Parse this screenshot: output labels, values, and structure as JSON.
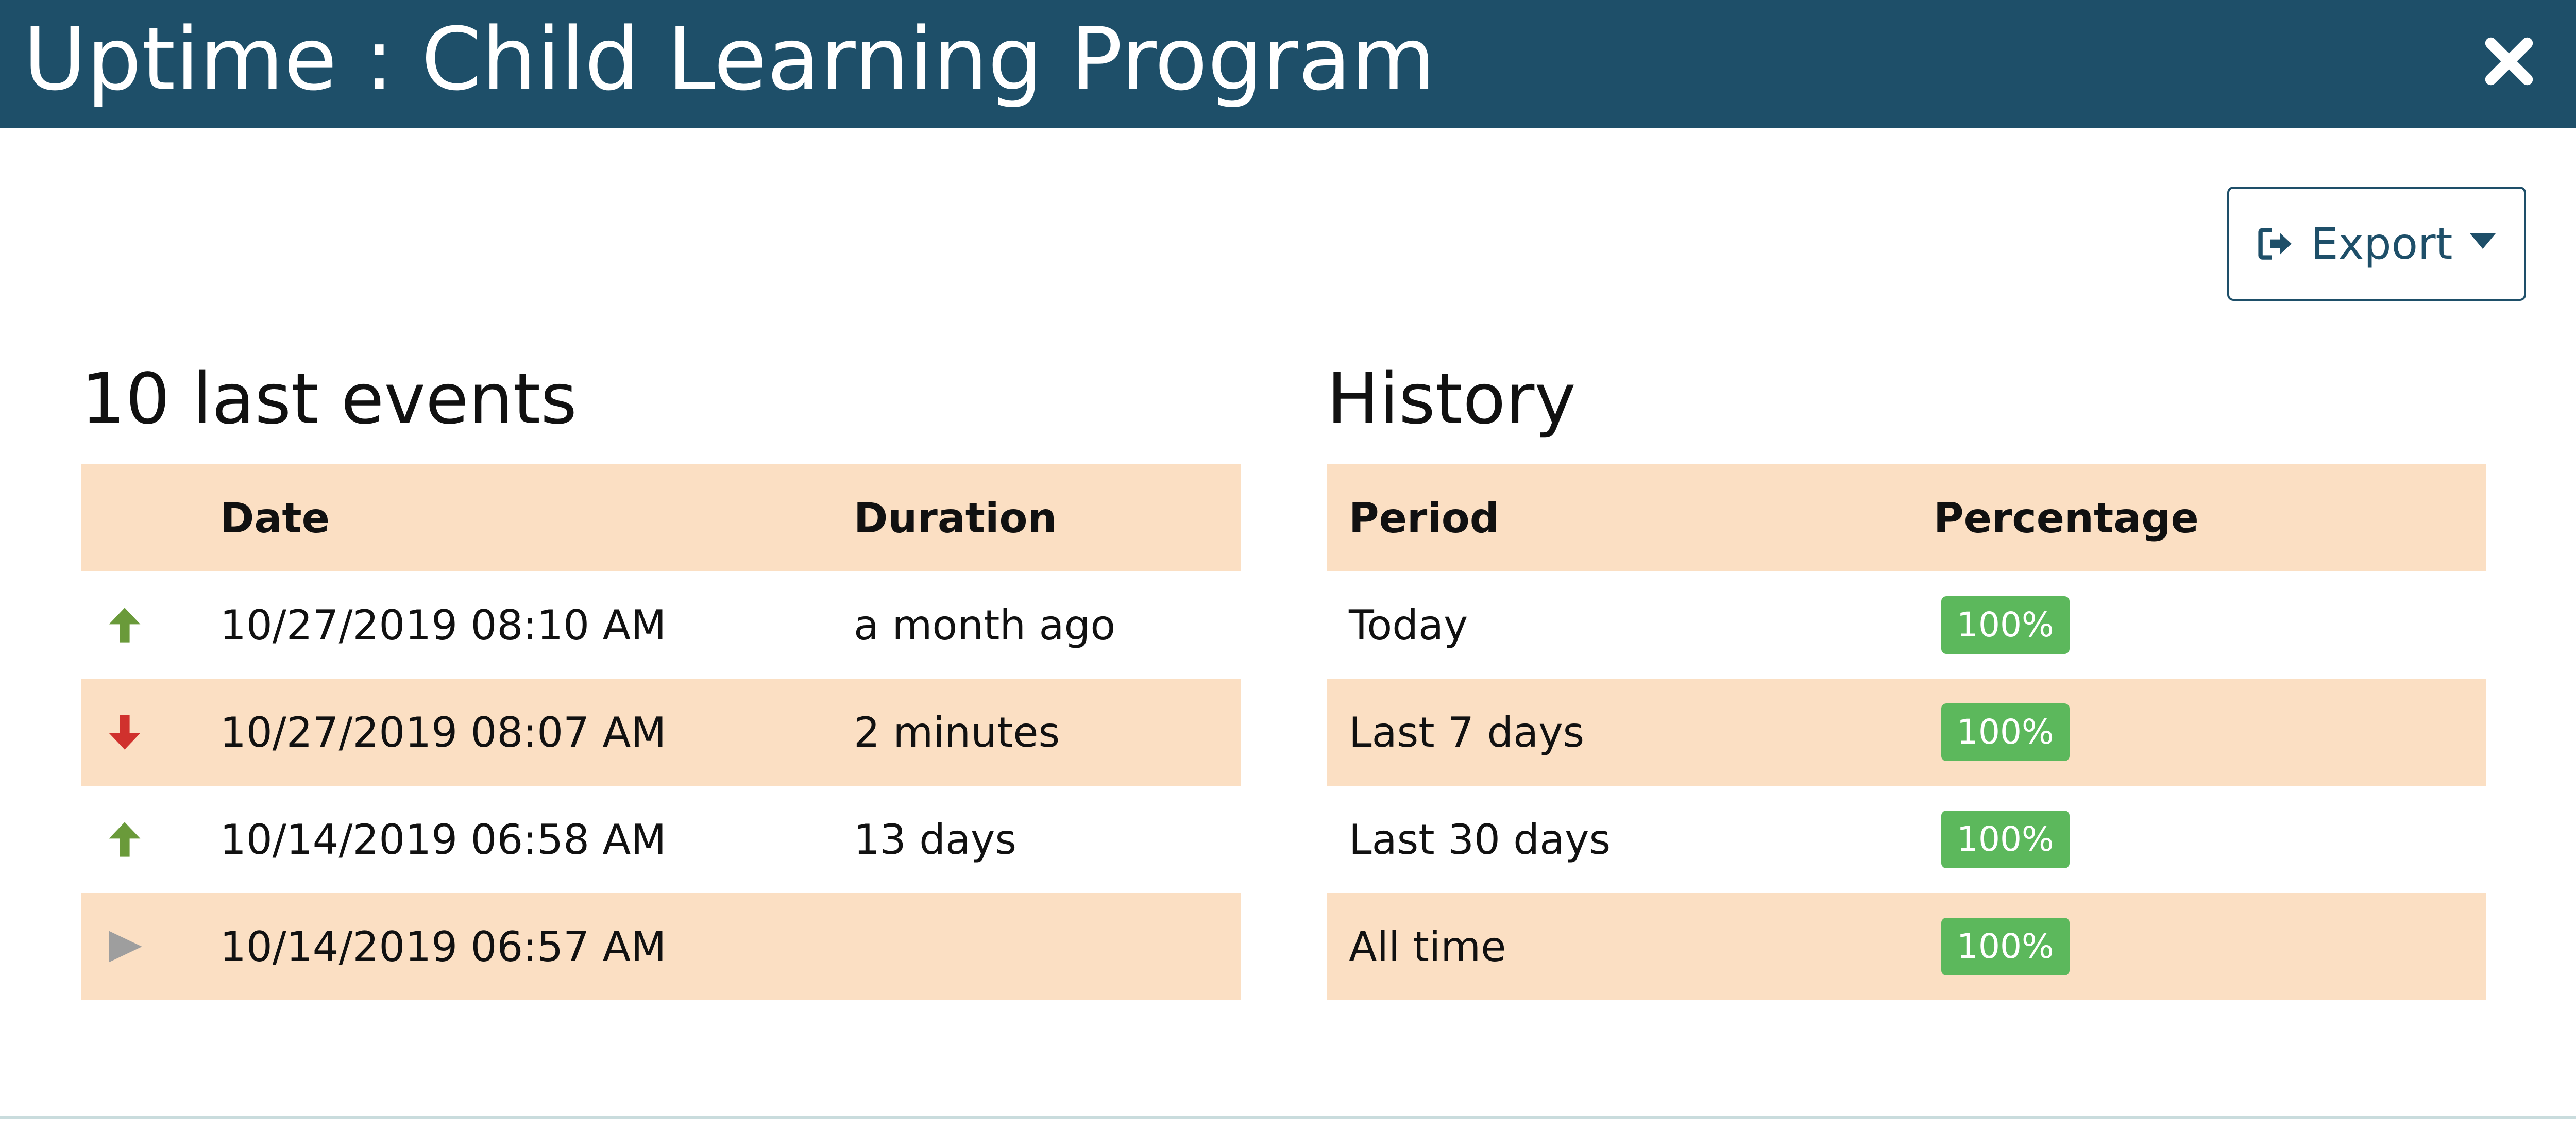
{
  "header": {
    "title": "Uptime : Child Learning Program",
    "close_icon": "close-icon"
  },
  "toolbar": {
    "export_label": "Export",
    "export_icon": "sign-out-icon",
    "caret_icon": "caret-down-icon"
  },
  "events": {
    "title": "10 last events",
    "columns": [
      "",
      "Date",
      "Duration"
    ],
    "rows": [
      {
        "status": "up",
        "icon": "arrow-up-icon",
        "date": "10/27/2019 08:10 AM",
        "duration": "a month ago"
      },
      {
        "status": "down",
        "icon": "arrow-down-icon",
        "date": "10/27/2019 08:07 AM",
        "duration": "2 minutes"
      },
      {
        "status": "up",
        "icon": "arrow-up-icon",
        "date": "10/14/2019 06:58 AM",
        "duration": "13 days"
      },
      {
        "status": "started",
        "icon": "play-icon",
        "date": "10/14/2019 06:57 AM",
        "duration": ""
      }
    ]
  },
  "history": {
    "title": "History",
    "columns": [
      "Period",
      "Percentage"
    ],
    "rows": [
      {
        "period": "Today",
        "percentage": "100%"
      },
      {
        "period": "Last 7 days",
        "percentage": "100%"
      },
      {
        "period": "Last 30 days",
        "percentage": "100%"
      },
      {
        "period": "All time",
        "percentage": "100%"
      }
    ]
  },
  "colors": {
    "header_bg": "#1e4f69",
    "row_shade": "#fbdfc3",
    "up_arrow": "#6a9a3a",
    "down_arrow": "#d0312d",
    "started_icon": "#9e9e9e",
    "badge_green": "#5cb85c"
  }
}
